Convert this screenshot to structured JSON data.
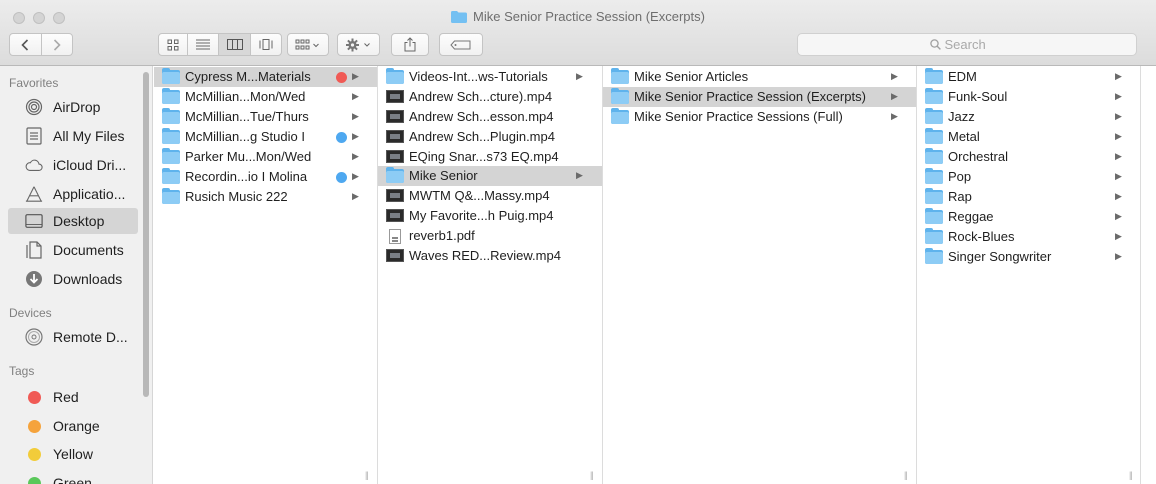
{
  "window": {
    "title": "Mike Senior Practice Session (Excerpts)"
  },
  "toolbar": {
    "search_placeholder": "Search",
    "icons": [
      "back-arrow-icon",
      "forward-arrow-icon",
      "icon-view-icon",
      "list-view-icon",
      "column-view-icon",
      "cover-flow-icon",
      "arrange-icon",
      "action-gear-icon",
      "share-icon",
      "tag-icon"
    ]
  },
  "sidebar": {
    "favorites_header": "Favorites",
    "devices_header": "Devices",
    "tags_header": "Tags",
    "favorites": [
      {
        "label": "AirDrop",
        "icon": "airdrop-icon"
      },
      {
        "label": "All My Files",
        "icon": "all-files-icon"
      },
      {
        "label": "iCloud Dri...",
        "icon": "cloud-icon"
      },
      {
        "label": "Applicatio...",
        "icon": "applications-icon"
      },
      {
        "label": "Desktop",
        "icon": "desktop-icon",
        "selected": true
      },
      {
        "label": "Documents",
        "icon": "documents-icon"
      },
      {
        "label": "Downloads",
        "icon": "downloads-icon"
      }
    ],
    "devices": [
      {
        "label": "Remote D...",
        "icon": "disc-icon"
      }
    ],
    "tags": [
      {
        "label": "Red",
        "color": "#f05a55"
      },
      {
        "label": "Orange",
        "color": "#f5a33c"
      },
      {
        "label": "Yellow",
        "color": "#f2cc3a"
      },
      {
        "label": "Green",
        "color": "#5ac85a"
      }
    ]
  },
  "columns": {
    "col1": [
      {
        "name": "Cypress M...Materials",
        "kind": "folder",
        "selected": true,
        "tag": "#f05a55",
        "arrow": true
      },
      {
        "name": "McMillian...Mon/Wed",
        "kind": "folder",
        "arrow": true
      },
      {
        "name": "McMillian...Tue/Thurs",
        "kind": "folder",
        "arrow": true
      },
      {
        "name": "McMillian...g Studio I",
        "kind": "folder",
        "tag": "#4ea8f0",
        "arrow": true
      },
      {
        "name": "Parker Mu...Mon/Wed",
        "kind": "folder",
        "arrow": true
      },
      {
        "name": "Recordin...io I Molina",
        "kind": "folder",
        "tag": "#4ea8f0",
        "arrow": true
      },
      {
        "name": "Rusich Music 222",
        "kind": "folder",
        "arrow": true
      }
    ],
    "col2": [
      {
        "name": "Videos-Int...ws-Tutorials",
        "kind": "folder",
        "arrow": true
      },
      {
        "name": "Andrew Sch...cture).mp4",
        "kind": "video"
      },
      {
        "name": "Andrew Sch...esson.mp4",
        "kind": "video"
      },
      {
        "name": "Andrew Sch...Plugin.mp4",
        "kind": "video"
      },
      {
        "name": "EQing Snar...s73 EQ.mp4",
        "kind": "video"
      },
      {
        "name": "Mike Senior",
        "kind": "folder",
        "selected": true,
        "arrow": true
      },
      {
        "name": "MWTM Q&...Massy.mp4",
        "kind": "video"
      },
      {
        "name": "My Favorite...h Puig.mp4",
        "kind": "video"
      },
      {
        "name": "reverb1.pdf",
        "kind": "pdf"
      },
      {
        "name": "Waves RED...Review.mp4",
        "kind": "video"
      }
    ],
    "col3": [
      {
        "name": "Mike Senior Articles",
        "kind": "folder",
        "arrow": true
      },
      {
        "name": "Mike Senior Practice Session (Excerpts)",
        "kind": "folder",
        "selected": true,
        "arrow": true
      },
      {
        "name": "Mike Senior Practice Sessions (Full)",
        "kind": "folder",
        "arrow": true
      }
    ],
    "col4": [
      {
        "name": "EDM",
        "kind": "folder",
        "arrow": true
      },
      {
        "name": "Funk-Soul",
        "kind": "folder",
        "arrow": true
      },
      {
        "name": "Jazz",
        "kind": "folder",
        "arrow": true
      },
      {
        "name": "Metal",
        "kind": "folder",
        "arrow": true
      },
      {
        "name": "Orchestral",
        "kind": "folder",
        "arrow": true
      },
      {
        "name": "Pop",
        "kind": "folder",
        "arrow": true
      },
      {
        "name": "Rap",
        "kind": "folder",
        "arrow": true
      },
      {
        "name": "Reggae",
        "kind": "folder",
        "arrow": true
      },
      {
        "name": "Rock-Blues",
        "kind": "folder",
        "arrow": true
      },
      {
        "name": "Singer Songwriter",
        "kind": "folder",
        "arrow": true
      }
    ]
  }
}
